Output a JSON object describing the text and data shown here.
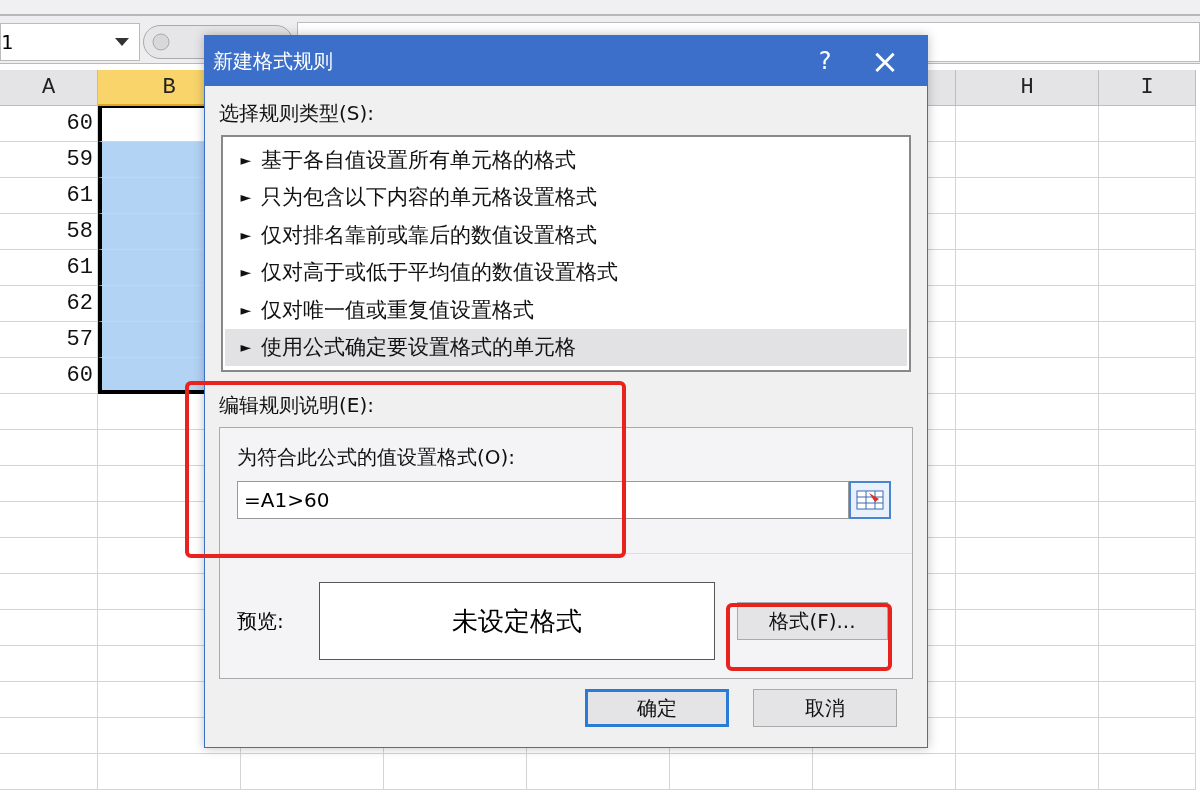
{
  "name_box": "1",
  "column_headers": [
    {
      "label": "A",
      "selected": false
    },
    {
      "label": "B",
      "selected": true
    },
    {
      "label": "H",
      "selected": false
    },
    {
      "label": "I",
      "selected": false
    }
  ],
  "rows": [
    {
      "a": "60",
      "b_selected": true,
      "b_active": true
    },
    {
      "a": "59",
      "b_selected": true,
      "b_active": false
    },
    {
      "a": "61",
      "b_selected": true,
      "b_active": false
    },
    {
      "a": "58",
      "b_selected": true,
      "b_active": false
    },
    {
      "a": "61",
      "b_selected": true,
      "b_active": false
    },
    {
      "a": "62",
      "b_selected": true,
      "b_active": false
    },
    {
      "a": "57",
      "b_selected": true,
      "b_active": false
    },
    {
      "a": "60",
      "b_selected": true,
      "b_active": false
    }
  ],
  "dialog": {
    "title": "新建格式规则",
    "help": "?",
    "close": "×",
    "rule_type_label": "选择规则类型(S):",
    "rule_types": [
      {
        "label": "基于各自值设置所有单元格的格式",
        "selected": false
      },
      {
        "label": "只为包含以下内容的单元格设置格式",
        "selected": false
      },
      {
        "label": "仅对排名靠前或靠后的数值设置格式",
        "selected": false
      },
      {
        "label": "仅对高于或低于平均值的数值设置格式",
        "selected": false
      },
      {
        "label": "仅对唯一值或重复值设置格式",
        "selected": false
      },
      {
        "label": "使用公式确定要设置格式的单元格",
        "selected": true
      }
    ],
    "bullet": "►",
    "edit_label": "编辑规则说明(E):",
    "edit_highlighted": true,
    "formula_label": "为符合此公式的值设置格式(O):",
    "formula_value": "=A1>60",
    "preview_label": "预览:",
    "preview_text": "未设定格式",
    "format_button": {
      "label": "格式(F)...",
      "highlighted": true
    },
    "buttons": [
      {
        "label": "确定",
        "default": true
      },
      {
        "label": "取消",
        "default": false
      }
    ]
  }
}
